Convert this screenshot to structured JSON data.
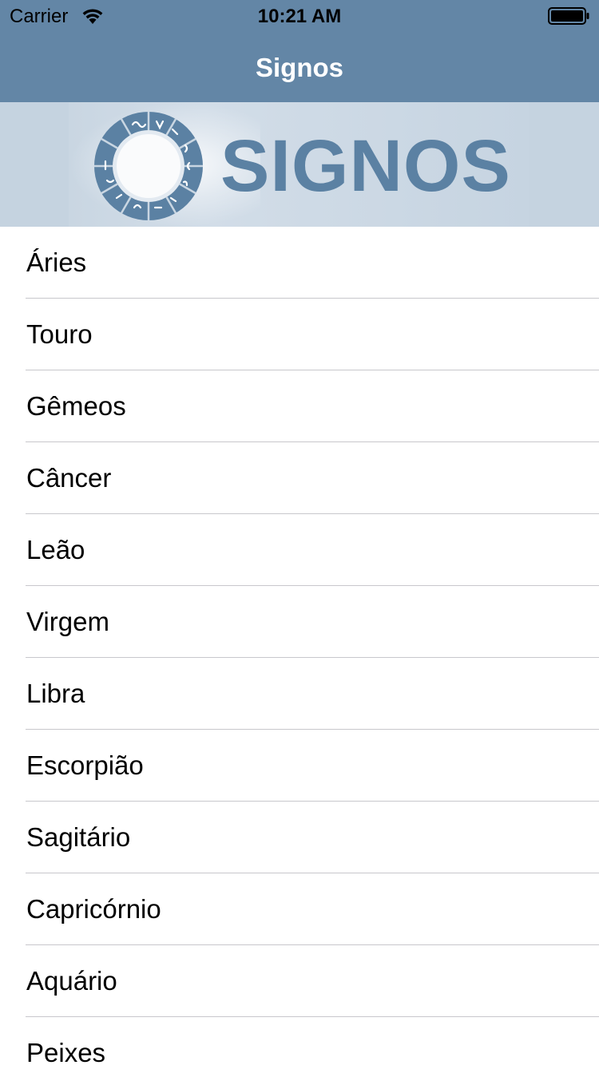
{
  "status_bar": {
    "carrier": "Carrier",
    "time": "10:21 AM"
  },
  "nav": {
    "title": "Signos"
  },
  "banner": {
    "logo_text": "SIGNOS",
    "logo_color": "#5b81a3"
  },
  "colors": {
    "nav_background": "#6386a6",
    "banner_background": "#c5d3e0",
    "separator": "#c8c7cc"
  },
  "signs": [
    {
      "label": "Áries"
    },
    {
      "label": "Touro"
    },
    {
      "label": "Gêmeos"
    },
    {
      "label": "Câncer"
    },
    {
      "label": "Leão"
    },
    {
      "label": "Virgem"
    },
    {
      "label": "Libra"
    },
    {
      "label": "Escorpião"
    },
    {
      "label": "Sagitário"
    },
    {
      "label": "Capricórnio"
    },
    {
      "label": "Aquário"
    },
    {
      "label": "Peixes"
    }
  ]
}
